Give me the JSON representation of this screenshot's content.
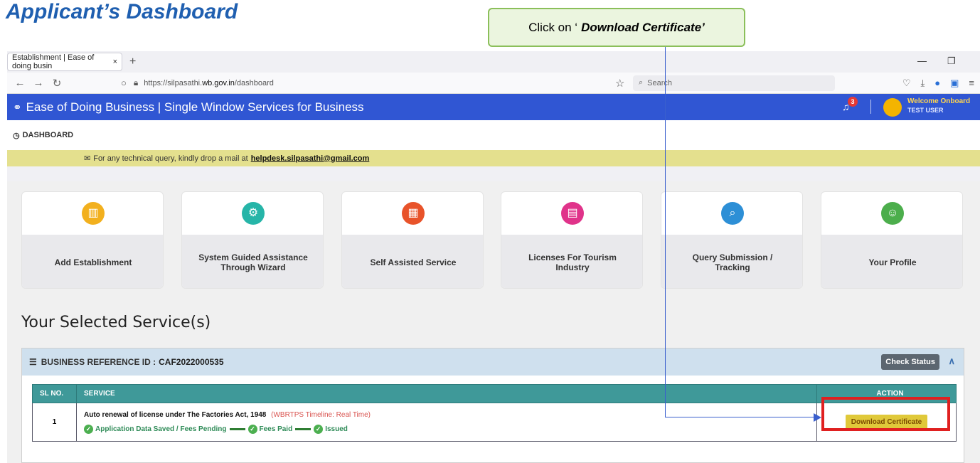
{
  "doc_title": "Applicant’s Dashboard",
  "callout": {
    "prefix": "Click on ‘",
    "emph": "Download Certificate’"
  },
  "browser": {
    "tab_title": "Establishment | Ease of doing busin",
    "tab_close": "×",
    "tab_add": "+",
    "url_prefix": "https://silpasathi.",
    "url_domain": "wb.gov.in",
    "url_path": "/dashboard",
    "search_placeholder": "Search"
  },
  "site": {
    "brand": "Ease of Doing Business | Single Window Services for Business",
    "notification_count": "3",
    "welcome": "Welcome Onboard",
    "user": "TEST USER",
    "menu_dashboard": "DASHBOARD",
    "notice_prefix": "For any technical query, kindly drop a mail at",
    "notice_email": "helpdesk.silpasathi@gmail.com"
  },
  "cards": [
    {
      "label": "Add Establishment",
      "icon": "building-icon",
      "color": "#f2b01e"
    },
    {
      "label": "System Guided Assistance Through Wizard",
      "icon": "gear-icon",
      "color": "#26b5a8"
    },
    {
      "label": "Self Assisted Service",
      "icon": "grid-icon",
      "color": "#e8532a"
    },
    {
      "label": "Licenses For Tourism Industry",
      "icon": "license-icon",
      "color": "#e0338a"
    },
    {
      "label": "Query Submission / Tracking",
      "icon": "search-icon",
      "color": "#2d8fd6"
    },
    {
      "label": "Your Profile",
      "icon": "profile-icon",
      "color": "#4cae4c"
    }
  ],
  "section_title": "Your Selected Service(s)",
  "panel": {
    "ref_label": "BUSINESS REFERENCE ID :",
    "ref_id": "CAF2022000535",
    "check_status": "Check Status",
    "col_slno": "SL NO.",
    "col_service": "SERVICE",
    "col_action": "ACTION",
    "rows": [
      {
        "slno": "1",
        "service": "Auto renewal of license under The Factories Act, 1948",
        "timeline": "(WBRTPS Timeline: Real Time)",
        "step1": "Application Data Saved / Fees Pending",
        "step2": "Fees Paid",
        "step3": "Issued",
        "action": "Download Certificate"
      }
    ]
  }
}
